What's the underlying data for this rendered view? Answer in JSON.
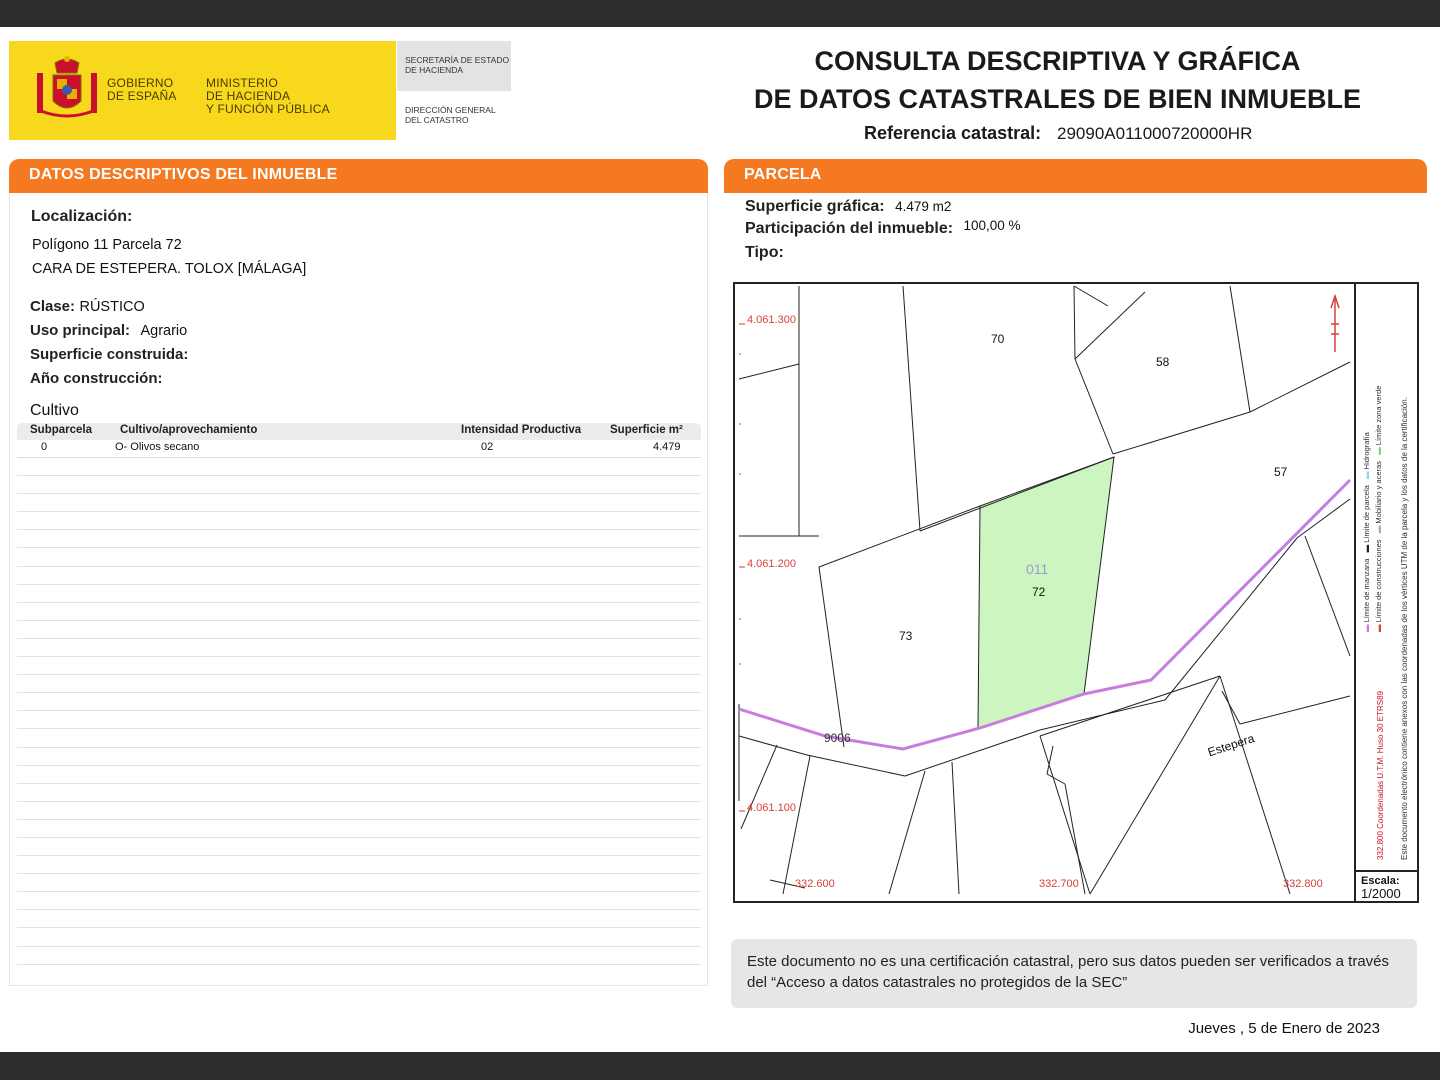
{
  "header": {
    "gobierno": [
      "GOBIERNO",
      "DE ESPAÑA"
    ],
    "ministerio": [
      "MINISTERIO",
      "DE HACIENDA",
      "Y FUNCIÓN PÚBLICA"
    ],
    "secretaria": [
      "SECRETARÍA DE ESTADO",
      "DE HACIENDA"
    ],
    "direccion": [
      "DIRECCIÓN GENERAL",
      "DEL CATASTRO"
    ],
    "title_line1": "CONSULTA DESCRIPTIVA Y GRÁFICA",
    "title_line2": "DE DATOS CATASTRALES DE BIEN INMUEBLE",
    "ref_label": "Referencia catastral:",
    "ref_value": "29090A011000720000HR"
  },
  "descriptivos": {
    "section_title": "DATOS DESCRIPTIVOS DEL INMUEBLE",
    "localizacion_label": "Localización:",
    "localizacion_line1": "Polígono 11 Parcela 72",
    "localizacion_line2": "CARA DE ESTEPERA. TOLOX [MÁLAGA]",
    "clase_label": "Clase:",
    "clase_value": "RÚSTICO",
    "uso_label": "Uso principal:",
    "uso_value": "Agrario",
    "superficie_construida_label": "Superficie construida:",
    "anio_label": "Año construcción:",
    "cultivo_title": "Cultivo",
    "cultivo_headers": [
      "Subparcela",
      "Cultivo/aprovechamiento",
      "Intensidad Productiva",
      "Superficie m²"
    ],
    "cultivo_rows": [
      {
        "subparcela": "0",
        "cultivo": "O- Olivos secano",
        "intensidad": "02",
        "superficie": "4.479"
      }
    ]
  },
  "parcela": {
    "section_title": "PARCELA",
    "superficie_label": "Superficie gráfica:",
    "superficie_value": "4.479 m2",
    "participacion_label": "Participación del inmueble:",
    "participacion_value": "100,00 %",
    "tipo_label": "Tipo:",
    "map_labels": {
      "parcel_70": "70",
      "parcel_58": "58",
      "parcel_57": "57",
      "parcel_73": "73",
      "parcel_72": "72",
      "polygon": "011",
      "road": "9006",
      "place": "Estepera",
      "north_1": "4.061.300",
      "north_2": "4.061.200",
      "north_3": "4.061.100",
      "east_1": "332.600",
      "east_2": "332.700",
      "east_3": "332.800"
    },
    "legend_col1": "Este documento electrónico contiene anexos con las coordenadas de los vértices UTM de la parcela y los datos de la certificación.",
    "legend_col2": "332.800 Coordenadas U.T.M. Huso 30 ETRS89",
    "legend_items": [
      "Límite de manzana",
      "Límite de parcela",
      "Límite de construcciones",
      "Mobiliario y aceras",
      "Hidrografía",
      "Límite zona verde"
    ],
    "scale_label": "Escala:",
    "scale_value": "1/2000",
    "colors": {
      "parcel_fill": "#ccf5c0",
      "road": "#c77de0",
      "coord_text": "#d9403a",
      "accent": "#f47920"
    }
  },
  "footer": {
    "note": "Este documento no es una certificación catastral, pero sus datos pueden ser verificados a través del “Acceso a datos catastrales no protegidos de la SEC”",
    "date": "Jueves , 5 de Enero de 2023"
  }
}
